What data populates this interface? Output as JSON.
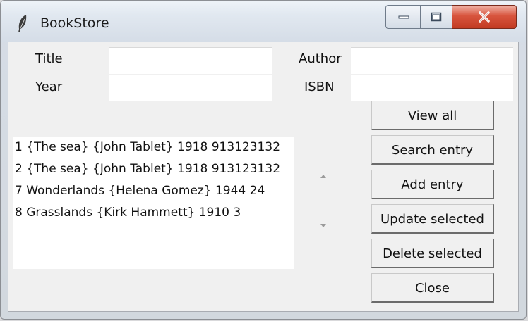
{
  "window": {
    "title": "BookStore"
  },
  "form": {
    "title_label": "Title",
    "author_label": "Author",
    "year_label": "Year",
    "isbn_label": "ISBN",
    "title_value": "",
    "author_value": "",
    "year_value": "",
    "isbn_value": ""
  },
  "list": {
    "items": [
      "1 {The sea} {John Tablet} 1918 913123132",
      "2 {The sea} {John Tablet} 1918 913123132",
      "7 Wonderlands {Helena Gomez} 1944 24",
      "8 Grasslands {Kirk Hammett} 1910 3"
    ]
  },
  "buttons": {
    "view_all": "View all",
    "search": "Search entry",
    "add": "Add entry",
    "update": "Update selected",
    "delete": "Delete selected",
    "close": "Close"
  }
}
